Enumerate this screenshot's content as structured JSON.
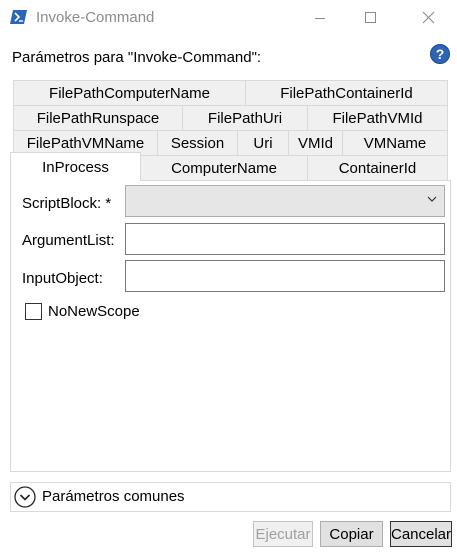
{
  "window": {
    "title": "Invoke-Command",
    "controls": {
      "minimize": "minimize-icon",
      "maximize": "maximize-icon",
      "close": "close-icon"
    }
  },
  "header": {
    "params_label": "Parámetros para \"Invoke-Command\":",
    "help_icon": "help-icon"
  },
  "tabs": {
    "row1": [
      "FilePathComputerName",
      "FilePathContainerId"
    ],
    "row2": [
      "FilePathRunspace",
      "FilePathUri",
      "FilePathVMId"
    ],
    "row3": [
      "FilePathVMName",
      "Session",
      "Uri",
      "VMId",
      "VMName"
    ],
    "row4": [
      "InProcess",
      "ComputerName",
      "ContainerId"
    ],
    "active": "InProcess"
  },
  "form": {
    "scriptblock": {
      "label": "ScriptBlock: *",
      "value": ""
    },
    "argumentlist": {
      "label": "ArgumentList:",
      "value": ""
    },
    "inputobject": {
      "label": "InputObject:",
      "value": ""
    },
    "nonewscope": {
      "label": "NoNewScope",
      "checked": false
    }
  },
  "common_params": {
    "label": "Parámetros comunes",
    "icon": "chevron-down-circle-icon"
  },
  "buttons": {
    "run": "Ejecutar",
    "copy": "Copiar",
    "cancel": "Cancelar"
  },
  "colors": {
    "accent": "#1f6ac2",
    "border": "#d9d9d9",
    "tab_bg": "#f0f0f0",
    "disabled_text": "#a0a0a0"
  }
}
